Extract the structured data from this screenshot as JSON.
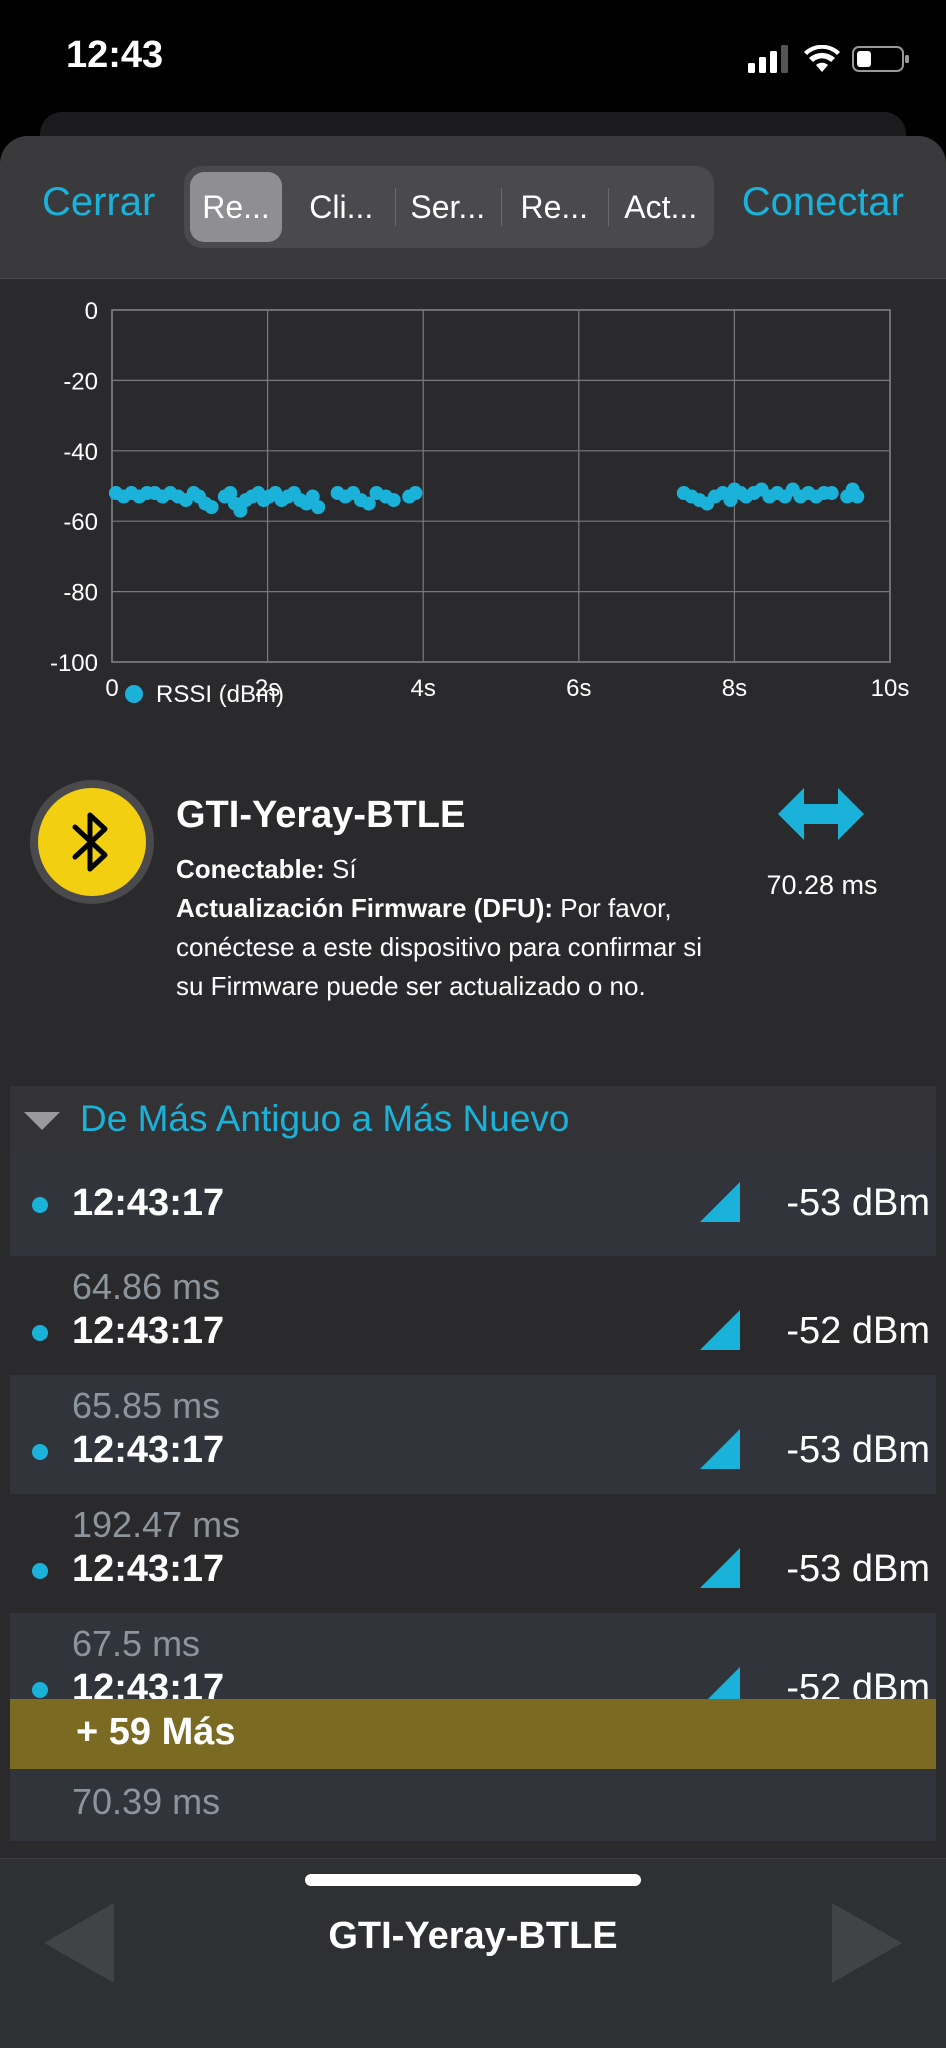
{
  "status_bar": {
    "time": "12:43",
    "icons": [
      "cellular-signal-icon",
      "wifi-icon",
      "battery-icon"
    ]
  },
  "nav": {
    "close_label": "Cerrar",
    "connect_label": "Conectar",
    "tabs": [
      {
        "label": "Re...",
        "active": true
      },
      {
        "label": "Cli...",
        "active": false
      },
      {
        "label": "Ser...",
        "active": false
      },
      {
        "label": "Re...",
        "active": false
      },
      {
        "label": "Act...",
        "active": false
      }
    ]
  },
  "chart_data": {
    "type": "scatter",
    "title": "",
    "xlabel": "",
    "ylabel": "",
    "xlim": [
      0,
      10
    ],
    "ylim": [
      -100,
      0
    ],
    "x_ticks": [
      "0",
      "2s",
      "4s",
      "6s",
      "8s",
      "10s"
    ],
    "y_ticks": [
      "0",
      "-20",
      "-40",
      "-60",
      "-80",
      "-100"
    ],
    "grid": true,
    "legend": "bottom-left",
    "series": [
      {
        "name": "RSSI (dBm)",
        "color": "#1bb2da",
        "points": [
          [
            0.05,
            -52
          ],
          [
            0.15,
            -53
          ],
          [
            0.25,
            -52
          ],
          [
            0.35,
            -53
          ],
          [
            0.45,
            -52
          ],
          [
            0.55,
            -52
          ],
          [
            0.65,
            -53
          ],
          [
            0.75,
            -52
          ],
          [
            0.85,
            -53
          ],
          [
            0.95,
            -54
          ],
          [
            1.05,
            -52
          ],
          [
            1.12,
            -53
          ],
          [
            1.2,
            -55
          ],
          [
            1.28,
            -56
          ],
          [
            1.45,
            -53
          ],
          [
            1.52,
            -52
          ],
          [
            1.58,
            -55
          ],
          [
            1.65,
            -57
          ],
          [
            1.72,
            -54
          ],
          [
            1.8,
            -53
          ],
          [
            1.88,
            -52
          ],
          [
            1.95,
            -54
          ],
          [
            2.02,
            -53
          ],
          [
            2.1,
            -52
          ],
          [
            2.18,
            -54
          ],
          [
            2.26,
            -53
          ],
          [
            2.34,
            -52
          ],
          [
            2.42,
            -54
          ],
          [
            2.5,
            -55
          ],
          [
            2.58,
            -53
          ],
          [
            2.65,
            -56
          ],
          [
            2.9,
            -52
          ],
          [
            3.0,
            -53
          ],
          [
            3.1,
            -52
          ],
          [
            3.2,
            -54
          ],
          [
            3.3,
            -55
          ],
          [
            3.4,
            -52
          ],
          [
            3.52,
            -53
          ],
          [
            3.62,
            -54
          ],
          [
            3.82,
            -53
          ],
          [
            3.9,
            -52
          ],
          [
            7.35,
            -52
          ],
          [
            7.45,
            -53
          ],
          [
            7.55,
            -54
          ],
          [
            7.65,
            -55
          ],
          [
            7.75,
            -53
          ],
          [
            7.85,
            -52
          ],
          [
            7.95,
            -54
          ],
          [
            8.0,
            -51
          ],
          [
            8.08,
            -52
          ],
          [
            8.15,
            -53
          ],
          [
            8.25,
            -52
          ],
          [
            8.35,
            -51
          ],
          [
            8.45,
            -53
          ],
          [
            8.55,
            -52
          ],
          [
            8.65,
            -53
          ],
          [
            8.75,
            -51
          ],
          [
            8.85,
            -53
          ],
          [
            8.95,
            -52
          ],
          [
            9.05,
            -53
          ],
          [
            9.15,
            -52
          ],
          [
            9.25,
            -52
          ],
          [
            9.45,
            -53
          ],
          [
            9.52,
            -51
          ],
          [
            9.58,
            -53
          ]
        ]
      }
    ]
  },
  "device": {
    "name": "GTI-Yeray-BTLE",
    "connectable_label": "Conectable:",
    "connectable_value": " Sí",
    "dfu_label": "Actualización Firmware (DFU):",
    "dfu_value": " Por favor, conéctese a este dispositivo para confirmar si su Firmware puede ser actualizado o no.",
    "interval_value": "70.28 ms",
    "icon": "bluetooth-icon",
    "interval_icon": "double-arrow-icon"
  },
  "advertisements": {
    "header": "De Más Antiguo a Más Nuevo",
    "rows": [
      {
        "interval": "",
        "time": "12:43:17",
        "rssi": "-53 dBm"
      },
      {
        "interval": "64.86 ms",
        "time": "12:43:17",
        "rssi": "-52 dBm"
      },
      {
        "interval": "65.85 ms",
        "time": "12:43:17",
        "rssi": "-53 dBm"
      },
      {
        "interval": "192.47 ms",
        "time": "12:43:17",
        "rssi": "-53 dBm"
      },
      {
        "interval": "67.5 ms",
        "time": "12:43:17",
        "rssi": "-52 dBm"
      }
    ],
    "more_label": "+ 59 Más",
    "partial_interval": "70.39 ms"
  },
  "bottom_bar": {
    "title": "GTI-Yeray-BTLE"
  },
  "colors": {
    "accent": "#1bb2da",
    "more_bar": "#7a6a22",
    "bluetooth_yellow": "#f3cf12"
  }
}
